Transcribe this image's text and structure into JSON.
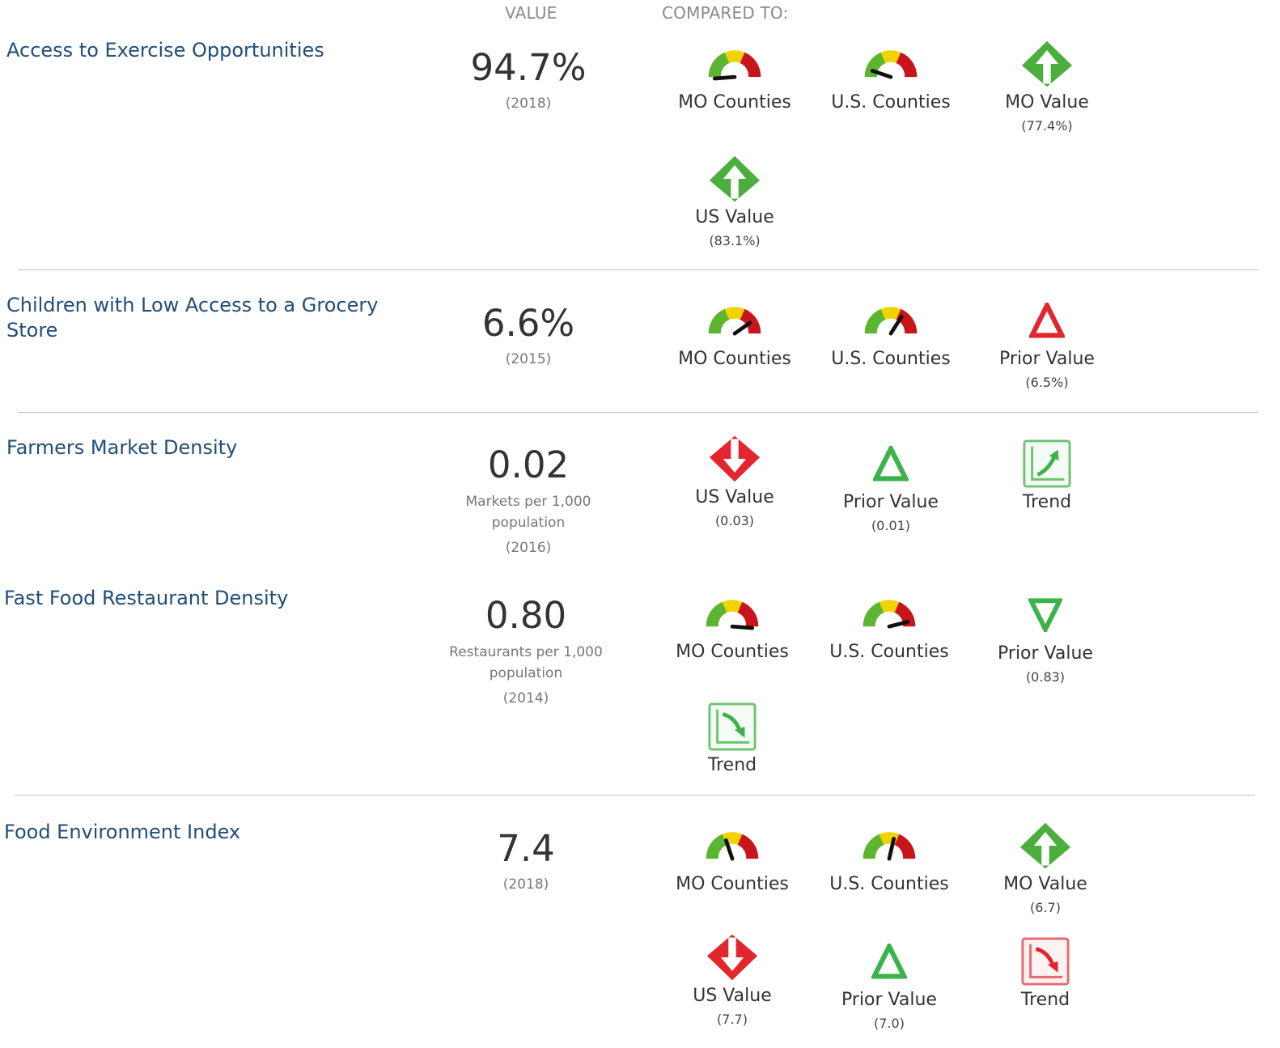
{
  "header": {
    "value_label": "VALUE",
    "compared_label": "COMPARED TO:"
  },
  "colors": {
    "green": "#2eae38",
    "yellow": "#eed300",
    "red": "#e1232b",
    "title_blue": "#1f4e79"
  },
  "indicators": [
    {
      "title": "Access to Exercise Opportunities",
      "value": "94.7%",
      "year": "(2018)",
      "comparisons": [
        {
          "icon": "gauge-icon",
          "label": "MO Counties"
        },
        {
          "icon": "gauge-icon",
          "label": "U.S. Counties"
        },
        {
          "icon": "green-up-diamond-icon",
          "label": "MO Value",
          "sub": "(77.4%)"
        },
        {
          "icon": "green-up-diamond-icon",
          "label": "US Value",
          "sub": "(83.1%)"
        }
      ]
    },
    {
      "title": "Children with Low Access to a Grocery Store",
      "value": "6.6%",
      "year": "(2015)",
      "comparisons": [
        {
          "icon": "gauge-icon",
          "label": "MO Counties"
        },
        {
          "icon": "gauge-icon",
          "label": "U.S. Counties"
        },
        {
          "icon": "red-up-triangle-icon",
          "label": "Prior Value",
          "sub": "(6.5%)"
        }
      ]
    },
    {
      "title": "Farmers Market Density",
      "value": "0.02",
      "unit": "Markets per 1,000 population",
      "year": "(2016)",
      "comparisons": [
        {
          "icon": "red-down-diamond-icon",
          "label": "US Value",
          "sub": "(0.03)"
        },
        {
          "icon": "green-up-triangle-icon",
          "label": "Prior Value",
          "sub": "(0.01)"
        },
        {
          "icon": "green-trend-up-icon",
          "label": "Trend"
        }
      ]
    },
    {
      "title": "Fast Food Restaurant Density",
      "value": "0.80",
      "unit": "Restaurants per 1,000 population",
      "year": "(2014)",
      "comparisons": [
        {
          "icon": "gauge-icon",
          "label": "MO Counties"
        },
        {
          "icon": "gauge-icon",
          "label": "U.S. Counties"
        },
        {
          "icon": "green-down-triangle-icon",
          "label": "Prior Value",
          "sub": "(0.83)"
        },
        {
          "icon": "green-trend-down-icon",
          "label": "Trend"
        }
      ]
    },
    {
      "title": "Food Environment Index",
      "value": "7.4",
      "year": "(2018)",
      "comparisons": [
        {
          "icon": "gauge-icon",
          "label": "MO Counties"
        },
        {
          "icon": "gauge-icon",
          "label": "U.S. Counties"
        },
        {
          "icon": "green-up-diamond-icon",
          "label": "MO Value",
          "sub": "(6.7)"
        },
        {
          "icon": "red-down-diamond-icon",
          "label": "US Value",
          "sub": "(7.7)"
        },
        {
          "icon": "green-up-triangle-icon",
          "label": "Prior Value",
          "sub": "(7.0)"
        },
        {
          "icon": "red-trend-down-icon",
          "label": "Trend"
        }
      ]
    }
  ]
}
